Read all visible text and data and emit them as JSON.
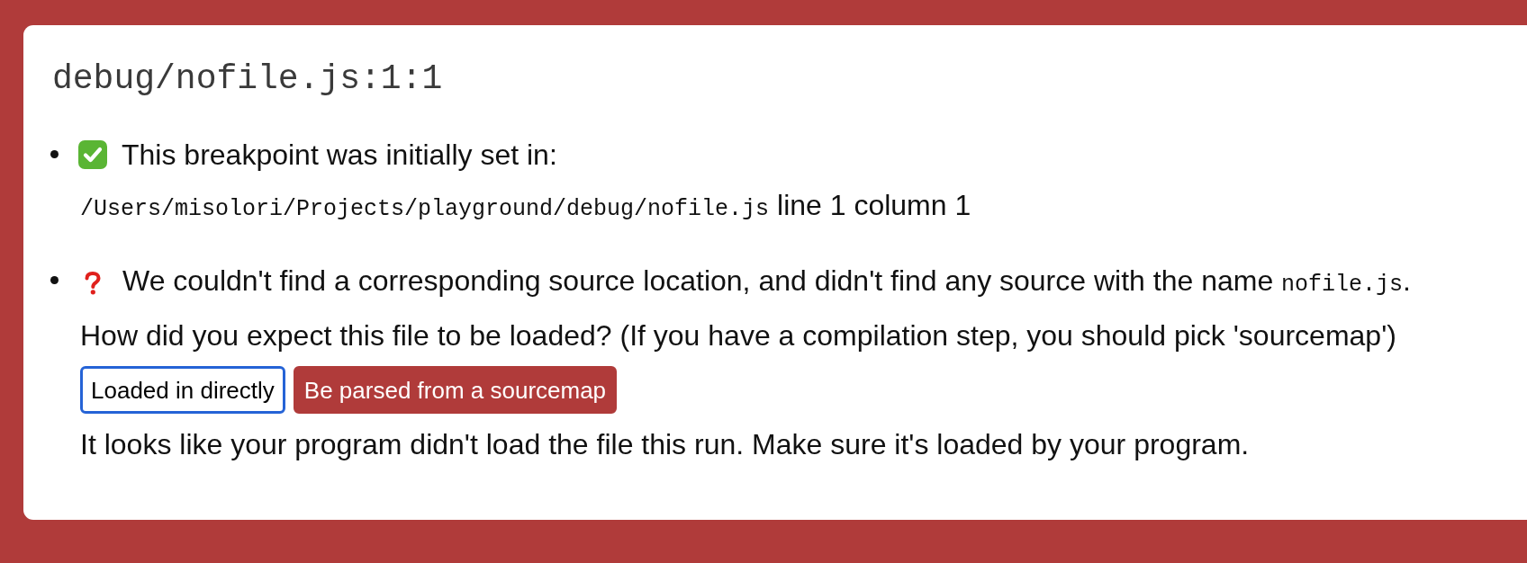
{
  "title": "debug/nofile.js:1:1",
  "items": [
    {
      "kind": "success",
      "blocks": [
        {
          "kind": "heading",
          "segments": [
            {
              "text": "This breakpoint was initially set in:",
              "code": false
            }
          ]
        },
        {
          "kind": "text",
          "segments": [
            {
              "text": "/Users/misolori/Projects/playground/debug/nofile.js",
              "code": true
            },
            {
              "text": " line 1 column 1",
              "code": false
            }
          ]
        }
      ]
    },
    {
      "kind": "missing",
      "blocks": [
        {
          "kind": "heading",
          "segments": [
            {
              "text": "We couldn't find a corresponding source location, and didn't find any source with the name ",
              "code": false
            },
            {
              "text": "nofile.js",
              "code": true
            },
            {
              "text": ".",
              "code": false
            }
          ]
        },
        {
          "kind": "text",
          "segments": [
            {
              "text": "How did you expect this file to be loaded? (If you have a compilation step, you should pick 'sourcemap')",
              "code": false
            }
          ]
        },
        {
          "kind": "buttons",
          "buttons": [
            {
              "label": "Loaded in directly",
              "kind": "default",
              "focused": true
            },
            {
              "label": "Be parsed from a sourcemap",
              "kind": "primary",
              "focused": false
            }
          ]
        },
        {
          "kind": "text",
          "segments": [
            {
              "text": "It looks like your program didn't load the file this run. Make sure it's loaded by your program.",
              "code": false
            }
          ]
        }
      ]
    }
  ]
}
